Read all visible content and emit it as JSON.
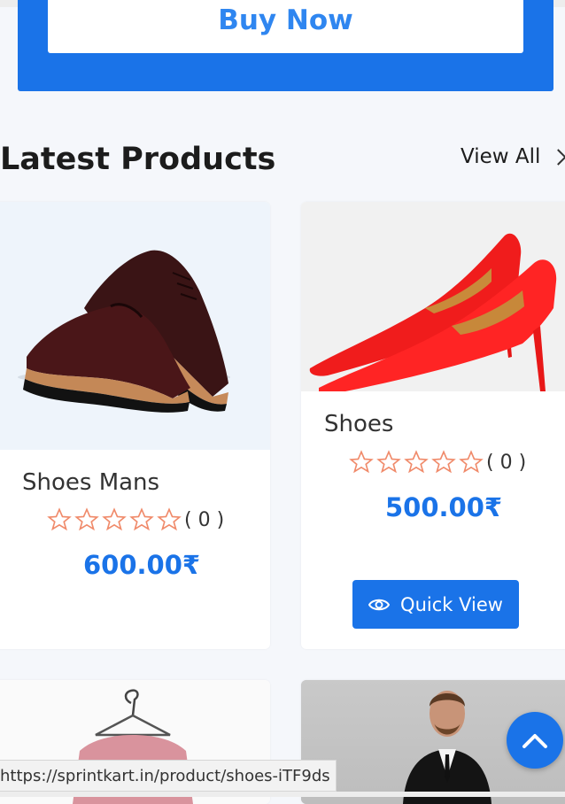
{
  "banner": {
    "buy_label": "Buy Now"
  },
  "section": {
    "title": "Latest Products",
    "view_all_label": "View All"
  },
  "products": [
    {
      "name": "Shoes Mans",
      "rating_count": "( 0 )",
      "price": "600.00₹",
      "image_icon": "brown-derby-shoes-image"
    },
    {
      "name": "Shoes",
      "rating_count": "( 0 )",
      "price": "500.00₹",
      "image_icon": "red-heels-image",
      "quick_view_label": "Quick View"
    },
    {
      "image_icon": "pink-shirt-on-hanger-image"
    },
    {
      "image_icon": "man-in-suit-image"
    }
  ],
  "status_bar": {
    "url": "https://sprintkart.in/product/shoes-iTF9ds"
  },
  "colors": {
    "accent": "#1a73e8",
    "star_outline": "#f08a6a"
  }
}
